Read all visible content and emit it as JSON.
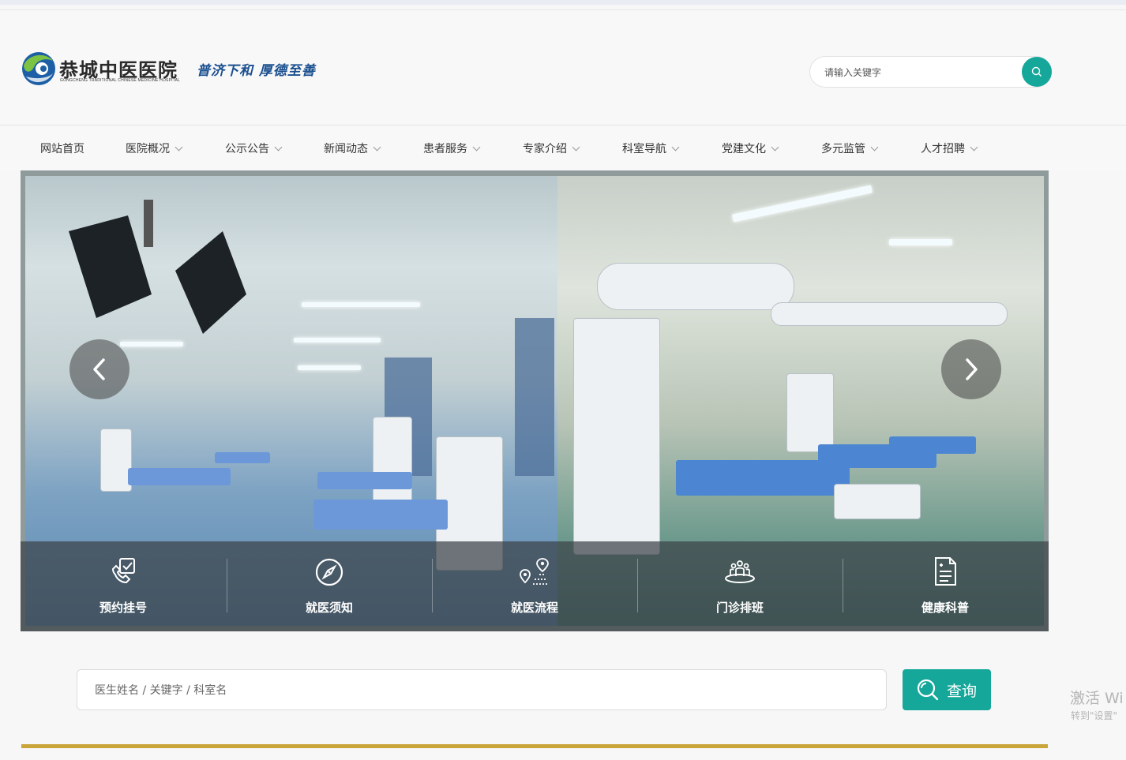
{
  "header": {
    "logo_cn": "恭城中医医院",
    "logo_en": "GONGCHENG TRADITIONAL CHINESE MEDICINE HOSPITAL",
    "logo_motto": "普济下和  厚德至善",
    "search_placeholder": "请输入关键字"
  },
  "nav": {
    "items": [
      {
        "label": "网站首页"
      },
      {
        "label": "医院概况"
      },
      {
        "label": "公示公告"
      },
      {
        "label": "新闻动态"
      },
      {
        "label": "患者服务"
      },
      {
        "label": "专家介绍"
      },
      {
        "label": "科室导航"
      },
      {
        "label": "党建文化"
      },
      {
        "label": "多元监管"
      },
      {
        "label": "人才招聘"
      }
    ]
  },
  "banner": {
    "quick_links": [
      {
        "label": "预约挂号",
        "icon": "phone-check-icon"
      },
      {
        "label": "就医须知",
        "icon": "compass-icon"
      },
      {
        "label": "就医流程",
        "icon": "route-pin-icon"
      },
      {
        "label": "门诊排班",
        "icon": "team-icon"
      },
      {
        "label": "健康科普",
        "icon": "document-icon"
      }
    ]
  },
  "doctor_search": {
    "placeholder": "医生姓名 / 关键字 / 科室名",
    "button_label": "查询"
  },
  "watermark": {
    "line1": "激活 Wi",
    "line2": "转到\"设置\""
  },
  "colors": {
    "accent": "#14a79a",
    "gold": "#c9a53a"
  }
}
